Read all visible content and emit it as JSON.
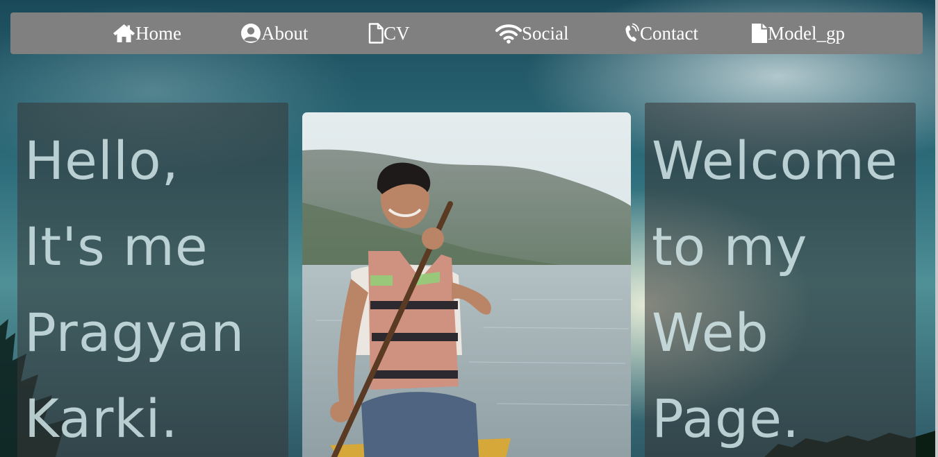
{
  "nav": {
    "items": [
      {
        "label": "Home",
        "icon": "home-icon"
      },
      {
        "label": "About",
        "icon": "user-circle-icon"
      },
      {
        "label": "CV",
        "icon": "document-outline-icon"
      },
      {
        "label": "Social",
        "icon": "wifi-icon"
      },
      {
        "label": "Contact",
        "icon": "phone-ringing-icon"
      },
      {
        "label": "Model_gp",
        "icon": "document-filled-icon"
      }
    ]
  },
  "left_panel": {
    "lines": [
      "Hello,",
      "It's me",
      "Pragyan",
      "Karki."
    ]
  },
  "right_panel": {
    "lines": [
      "Welcome",
      "to my",
      "Web",
      "Page."
    ]
  },
  "colors": {
    "navbar_bg": "#808080",
    "nav_text": "#ffffff",
    "panel_text": "#d7ecee"
  }
}
